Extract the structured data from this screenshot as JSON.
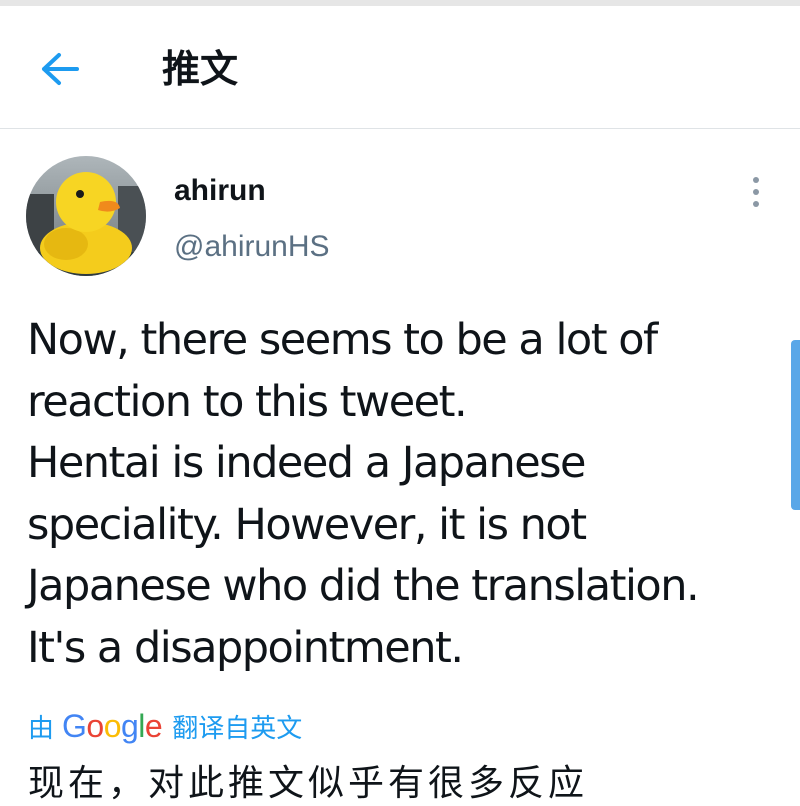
{
  "header": {
    "back_icon": "arrow-left-icon",
    "title": "推文"
  },
  "tweet": {
    "author": {
      "display_name": "ahirun",
      "handle": "@ahirunHS",
      "avatar_icon": "rubber-duck-avatar"
    },
    "more_icon": "vertical-ellipsis-icon",
    "lines": [
      "Now, there seems to be a lot of",
      "reaction to this tweet.",
      "Hentai is indeed a Japanese",
      "speciality. However, it is not",
      "Japanese who did the translation.",
      "It's a disappointment."
    ],
    "translation": {
      "by_label": "由",
      "google_letters": [
        "G",
        "o",
        "o",
        "g",
        "l",
        "e"
      ],
      "suffix_label": "翻译自英文"
    },
    "translated_text_partial": "现在，对此推文似乎有很多反应"
  },
  "colors": {
    "accent": "#1d9bf0",
    "secondary_text": "#5b7083",
    "primary_text": "#0f1419",
    "divider": "#dfe3e6",
    "google_blue": "#4285f4",
    "google_red": "#ea4335",
    "google_yellow": "#fbbc05",
    "google_green": "#34a853"
  }
}
